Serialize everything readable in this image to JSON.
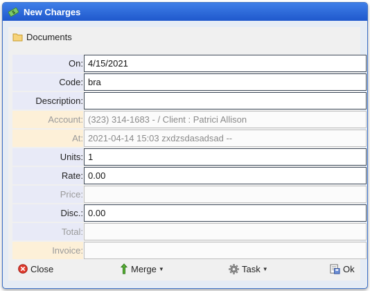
{
  "window": {
    "title": "New Charges"
  },
  "documents_label": "Documents",
  "fields": [
    {
      "label": "On:",
      "value": "4/15/2021",
      "readonly": false
    },
    {
      "label": "Code:",
      "value": "bra",
      "readonly": false
    },
    {
      "label": "Description:",
      "value": "",
      "readonly": false
    },
    {
      "label": "Account:",
      "value": "(323) 314-1683 -  / Client : Patrici Allison",
      "readonly": true
    },
    {
      "label": "At:",
      "value": "2021-04-14 15:03 zxdzsdasadsad --",
      "readonly": true
    },
    {
      "label": "Units:",
      "value": "1",
      "readonly": false
    },
    {
      "label": "Rate:",
      "value": "0.00",
      "readonly": false
    },
    {
      "label": "Price:",
      "value": "",
      "readonly": true
    },
    {
      "label": "Disc.:",
      "value": "0.00",
      "readonly": false
    },
    {
      "label": "Total:",
      "value": "",
      "readonly": true
    },
    {
      "label": "Invoice:",
      "value": "",
      "readonly": true
    }
  ],
  "footer": {
    "close_label": "Close",
    "merge_label": "Merge",
    "task_label": "Task",
    "ok_label": "Ok"
  }
}
